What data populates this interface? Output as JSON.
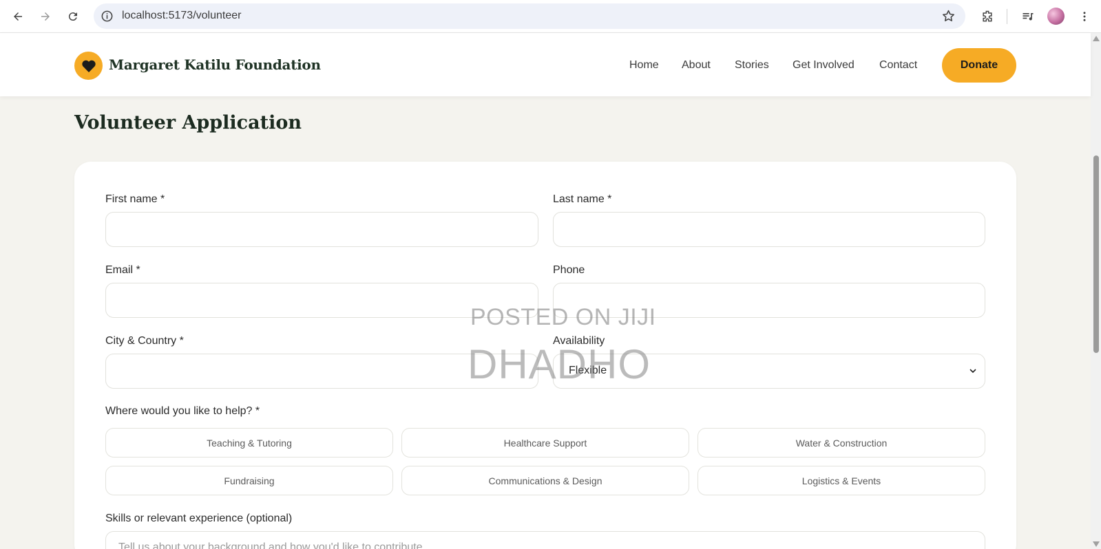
{
  "browser": {
    "url": "localhost:5173/volunteer"
  },
  "header": {
    "brand": "Margaret Katilu Foundation",
    "nav": [
      "Home",
      "About",
      "Stories",
      "Get Involved",
      "Contact"
    ],
    "donate_label": "Donate"
  },
  "page": {
    "title": "Volunteer Application"
  },
  "form": {
    "first_name_label": "First name *",
    "last_name_label": "Last name *",
    "email_label": "Email *",
    "phone_label": "Phone",
    "city_label": "City & Country *",
    "availability_label": "Availability",
    "availability_value": "Flexible",
    "help_label": "Where would you like to help? *",
    "help_options": [
      "Teaching & Tutoring",
      "Healthcare Support",
      "Water & Construction",
      "Fundraising",
      "Communications & Design",
      "Logistics & Events"
    ],
    "skills_label": "Skills or relevant experience (optional)",
    "skills_placeholder": "Tell us about your background and how you'd like to contribute..."
  },
  "watermark": {
    "line1": "POSTED ON JIJI",
    "line2": "DHADHO"
  },
  "colors": {
    "accent": "#f6ab25",
    "page_bg": "#f4f3ee",
    "heading": "#1c2b20"
  }
}
